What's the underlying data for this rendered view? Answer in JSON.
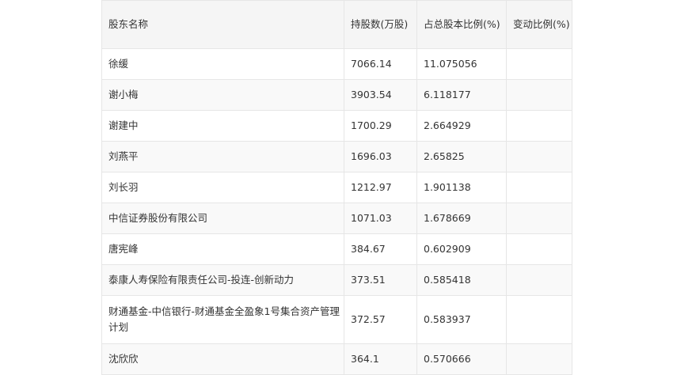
{
  "table": {
    "headers": [
      "股东名称",
      "持股数(万股)",
      "占总股本比例(%)",
      "变动比例(%)"
    ],
    "rows": [
      {
        "name": "徐缓",
        "shares": "7066.14",
        "ratio": "11.075056",
        "change": ""
      },
      {
        "name": "谢小梅",
        "shares": "3903.54",
        "ratio": "6.118177",
        "change": ""
      },
      {
        "name": "谢建中",
        "shares": "1700.29",
        "ratio": "2.664929",
        "change": ""
      },
      {
        "name": "刘燕平",
        "shares": "1696.03",
        "ratio": "2.65825",
        "change": ""
      },
      {
        "name": "刘长羽",
        "shares": "1212.97",
        "ratio": "1.901138",
        "change": ""
      },
      {
        "name": "中信证券股份有限公司",
        "shares": "1071.03",
        "ratio": "1.678669",
        "change": ""
      },
      {
        "name": "唐宪峰",
        "shares": "384.67",
        "ratio": "0.602909",
        "change": ""
      },
      {
        "name": "泰康人寿保险有限责任公司-投连-创新动力",
        "shares": "373.51",
        "ratio": "0.585418",
        "change": ""
      },
      {
        "name": "财通基金-中信银行-财通基金全盈象1号集合资产管理计划",
        "shares": "372.57",
        "ratio": "0.583937",
        "change": ""
      },
      {
        "name": "沈欣欣",
        "shares": "364.1",
        "ratio": "0.570666",
        "change": ""
      }
    ]
  }
}
